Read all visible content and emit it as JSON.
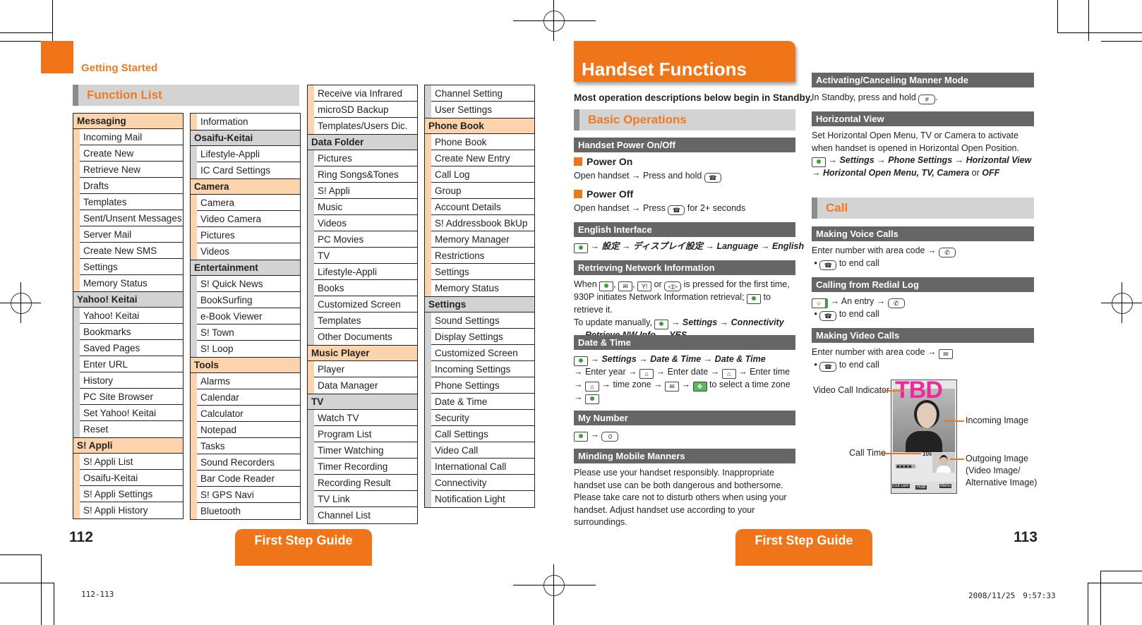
{
  "left_page": {
    "chapter": "Getting Started",
    "section_title": "Function List",
    "page_number": "112",
    "guide_tab": "First Step Guide",
    "footer_code": "112-113",
    "columns": [
      [
        {
          "category": "Messaging",
          "color": "orange",
          "items": [
            "Incoming Mail",
            "Create New",
            "Retrieve New",
            "Drafts",
            "Templates",
            "Sent/Unsent Messages",
            "Server Mail",
            "Create New SMS",
            "Settings",
            "Memory Status"
          ]
        },
        {
          "category": "Yahoo! Keitai",
          "color": "gray",
          "items": [
            "Yahoo! Keitai",
            "Bookmarks",
            "Saved Pages",
            "Enter URL",
            "History",
            "PC Site Browser",
            "Set Yahoo! Keitai",
            "Reset"
          ]
        },
        {
          "category": "S! Appli",
          "color": "orange",
          "items": [
            "S! Appli List",
            "Osaifu-Keitai",
            "S! Appli Settings",
            "S! Appli History"
          ]
        }
      ],
      [
        {
          "category": "",
          "color": "orange",
          "items": [
            "Information"
          ]
        },
        {
          "category": "Osaifu-Keitai",
          "color": "gray",
          "items": [
            "Lifestyle-Appli",
            "IC Card Settings"
          ]
        },
        {
          "category": "Camera",
          "color": "orange",
          "items": [
            "Camera",
            "Video Camera",
            "Pictures",
            "Videos"
          ]
        },
        {
          "category": "Entertainment",
          "color": "gray",
          "items": [
            "S! Quick News",
            "BookSurfing",
            "e-Book Viewer",
            "S! Town",
            "S! Loop"
          ]
        },
        {
          "category": "Tools",
          "color": "orange",
          "items": [
            "Alarms",
            "Calendar",
            "Calculator",
            "Notepad",
            "Tasks",
            "Sound Recorders",
            "Bar Code Reader",
            "S! GPS Navi",
            "Bluetooth"
          ]
        }
      ],
      [
        {
          "category": "",
          "color": "orange",
          "items": [
            "Receive via Infrared",
            "microSD Backup",
            "Templates/Users Dic."
          ]
        },
        {
          "category": "Data Folder",
          "color": "gray",
          "items": [
            "Pictures",
            "Ring Songs&Tones",
            "S! Appli",
            "Music",
            "Videos",
            "PC Movies",
            "TV",
            "Lifestyle-Appli",
            "Books",
            "Customized Screen",
            "Templates",
            "Other Documents"
          ]
        },
        {
          "category": "Music Player",
          "color": "orange",
          "items": [
            "Player",
            "Data Manager"
          ]
        },
        {
          "category": "TV",
          "color": "gray",
          "items": [
            "Watch TV",
            "Program List",
            "Timer Watching",
            "Timer Recording",
            "Recording Result",
            "TV Link",
            "Channel List"
          ]
        }
      ],
      [
        {
          "category": "",
          "color": "gray",
          "items": [
            "Channel Setting",
            "User Settings"
          ]
        },
        {
          "category": "Phone Book",
          "color": "orange",
          "items": [
            "Phone Book",
            "Create New Entry",
            "Call Log",
            "Group",
            "Account Details",
            "S! Addressbook BkUp",
            "Memory Manager",
            "Restrictions",
            "Settings",
            "Memory Status"
          ]
        },
        {
          "category": "Settings",
          "color": "gray",
          "items": [
            "Sound Settings",
            "Display Settings",
            "Customized Screen",
            "Incoming Settings",
            "Phone Settings",
            "Date & Time",
            "Security",
            "Call Settings",
            "Video Call",
            "International Call",
            "Connectivity",
            "Notification Light"
          ]
        }
      ]
    ]
  },
  "right_page": {
    "title": "Handset Functions",
    "lead": "Most operation descriptions below begin in Standby.",
    "page_number": "113",
    "guide_tab": "First Step Guide",
    "footer_timestamp": "2008/11/25　9:57:33",
    "basic_operations": "Basic Operations",
    "power": {
      "head": "Handset Power On/Off",
      "on_title": "Power On",
      "on_text_a": "Open handset → Press and hold",
      "off_title": "Power Off",
      "off_text_a": "Open handset → Press",
      "off_text_b": "for 2+ seconds"
    },
    "english": {
      "head": "English Interface",
      "path": "→ 設定 → ディスプレイ設定 → Language → English"
    },
    "network": {
      "head": "Retrieving Network Information",
      "t1": "When",
      "t2": ",",
      "t3": ",",
      "t4": "or",
      "t5": "is pressed for the first time,",
      "t6": "930P initiates Network Information retrieval;",
      "t7": "to retrieve it.",
      "t8": "To update manually,",
      "t9": "→ Settings → Connectivity",
      "t10": "→ Retrieve NW Info → YES"
    },
    "datetime": {
      "head": "Date & Time",
      "path": "→ Settings → Date & Time → Date & Time",
      "l2a": "→ Enter year →",
      "l2b": "→ Enter date →",
      "l2c": "→ Enter time",
      "l3a": "→",
      "l3b": "→ time zone →",
      "l3c": "→",
      "l3d": "to select a time zone",
      "l4": "→"
    },
    "mynumber": {
      "head": "My Number",
      "arrow": "→",
      "key": "0"
    },
    "manners": {
      "head": "Minding Mobile Manners",
      "text": "Please use your handset responsibly. Inappropriate handset use can be both dangerous and bothersome. Please take care not to disturb others when using your handset. Adjust handset use according to your surroundings."
    },
    "manner_mode": {
      "head": "Activating/Canceling Manner Mode",
      "text_a": "In Standby, press and hold",
      "key": "#",
      "text_b": "."
    },
    "horizontal": {
      "head": "Horizontal View",
      "text": "Set Horizontal Open Menu, TV or Camera to activate when handset is opened in Horizontal Open Position.",
      "path1": "→ Settings → Phone Settings → Horizontal View",
      "path2": "→ Horizontal Open Menu, TV, Camera",
      "or": "or",
      "off": "OFF"
    },
    "call_section": "Call",
    "voice": {
      "head": "Making Voice Calls",
      "l1": "Enter number with area code →",
      "l2": "to end call"
    },
    "redial": {
      "head": "Calling from Redial Log",
      "l1": "→ An entry →",
      "l2": "to end call"
    },
    "video": {
      "head": "Making Video Calls",
      "l1": "Enter number with area code →",
      "l2": "to end call"
    },
    "phone_figure": {
      "overlay": "TBD",
      "call_time_value": "10s",
      "softkey_left": "Out cam",
      "softkey_center": "Hold",
      "softkey_right": "Menu",
      "callouts": {
        "video_call_indicator": "Video Call Indicator",
        "call_time": "Call Time",
        "incoming_image": "Incoming Image",
        "outgoing_image_1": "Outgoing Image",
        "outgoing_image_2": "(Video Image/",
        "outgoing_image_3": "Alternative Image)"
      }
    }
  }
}
